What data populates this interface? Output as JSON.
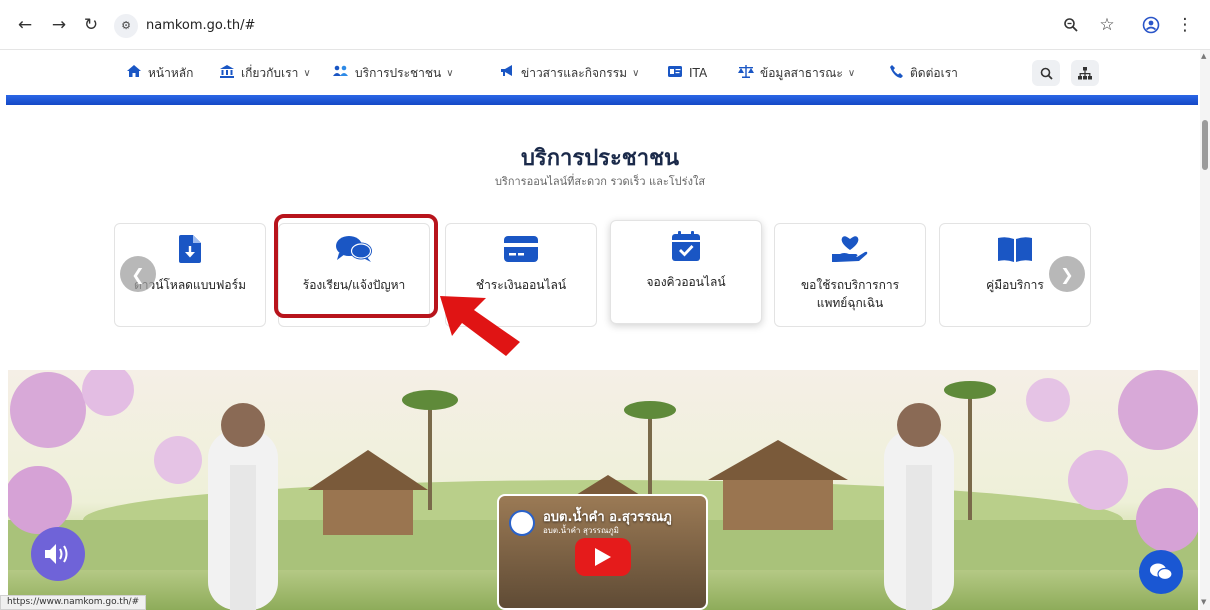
{
  "browser": {
    "url": "namkom.go.th/#",
    "status_url": "https://www.namkom.go.th/#"
  },
  "nav": {
    "items": [
      {
        "label": "หน้าหลัก",
        "icon": "home-icon"
      },
      {
        "label": "เกี่ยวกับเรา",
        "icon": "bank-icon",
        "dropdown": true
      },
      {
        "label": "บริการประชาชน",
        "icon": "users-icon",
        "dropdown": true
      },
      {
        "label": "ข่าวสารและกิจกรรม",
        "icon": "megaphone-icon",
        "dropdown": true
      },
      {
        "label": "ITA",
        "icon": "id-card-icon"
      },
      {
        "label": "ข้อมูลสาธารณะ",
        "icon": "scale-icon",
        "dropdown": true
      },
      {
        "label": "ติดต่อเรา",
        "icon": "phone-icon"
      }
    ]
  },
  "section": {
    "title": "บริการประชาชน",
    "subtitle": "บริการออนไลน์ที่สะดวก รวดเร็ว และโปร่งใส"
  },
  "services": [
    {
      "label": "ดาวน์โหลดแบบฟอร์ม",
      "icon": "file-download-icon"
    },
    {
      "label": "ร้องเรียน/แจ้งปัญหา",
      "icon": "chat-bubbles-icon"
    },
    {
      "label": "ชำระเงินออนไลน์",
      "icon": "credit-card-icon"
    },
    {
      "label": "จองคิวออนไลน์",
      "icon": "calendar-check-icon"
    },
    {
      "label": "ขอใช้รถบริการการแพทย์ฉุกเฉิน",
      "line1": "ขอใช้รถบริการการ",
      "line2": "แพทย์ฉุกเฉิน",
      "icon": "hand-heart-icon"
    },
    {
      "label": "คู่มือบริการ",
      "icon": "book-icon"
    }
  ],
  "video": {
    "title": "อบต.น้ำคำ อ.สุวรรณภู",
    "subtitle": "อบต.น้ำคำ สุวรรณภูมิ"
  },
  "colors": {
    "brand_blue": "#1a56c4",
    "highlight_red": "#b8141c",
    "arrow_red": "#e01414"
  }
}
